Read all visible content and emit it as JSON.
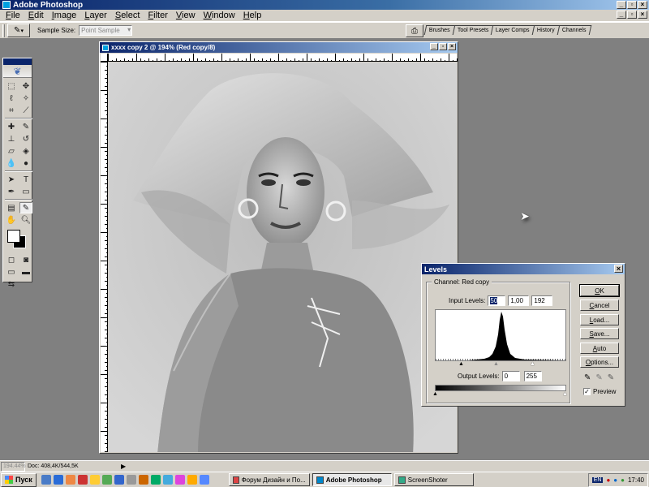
{
  "window": {
    "title": "Adobe Photoshop",
    "btn_min": "_",
    "btn_max": "▫",
    "btn_close": "×"
  },
  "menu": [
    "File",
    "Edit",
    "Image",
    "Layer",
    "Select",
    "Filter",
    "View",
    "Window",
    "Help"
  ],
  "options": {
    "sample_size_label": "Sample Size:",
    "sample_size_value": "Point Sample"
  },
  "palette_tabs": [
    "Brushes",
    "Tool Presets",
    "Layer Comps",
    "History",
    "Channels"
  ],
  "document": {
    "title": "xxxx copy 2 @ 194% (Red copy/8)"
  },
  "levels": {
    "title": "Levels",
    "channel_label": "Channel:",
    "channel_value": "Red copy",
    "input_label": "Input Levels:",
    "input_black": "50",
    "input_gamma": "1,00",
    "input_white": "192",
    "output_label": "Output Levels:",
    "output_black": "0",
    "output_white": "255",
    "buttons": [
      "OK",
      "Cancel",
      "Load...",
      "Save...",
      "Auto",
      "Options..."
    ],
    "preview_label": "Preview",
    "preview_checked": "✓"
  },
  "status": {
    "zoom": "194.44%",
    "doc": "Doc: 408,4K/544,5K"
  },
  "taskbar": {
    "start": "Пуск",
    "tasks": [
      {
        "label": "Форум Дизайн и По...",
        "active": false
      },
      {
        "label": "Adobe Photoshop",
        "active": true
      },
      {
        "label": "ScreenShoter",
        "active": false
      }
    ],
    "lang": "EN",
    "clock": "17:40"
  }
}
